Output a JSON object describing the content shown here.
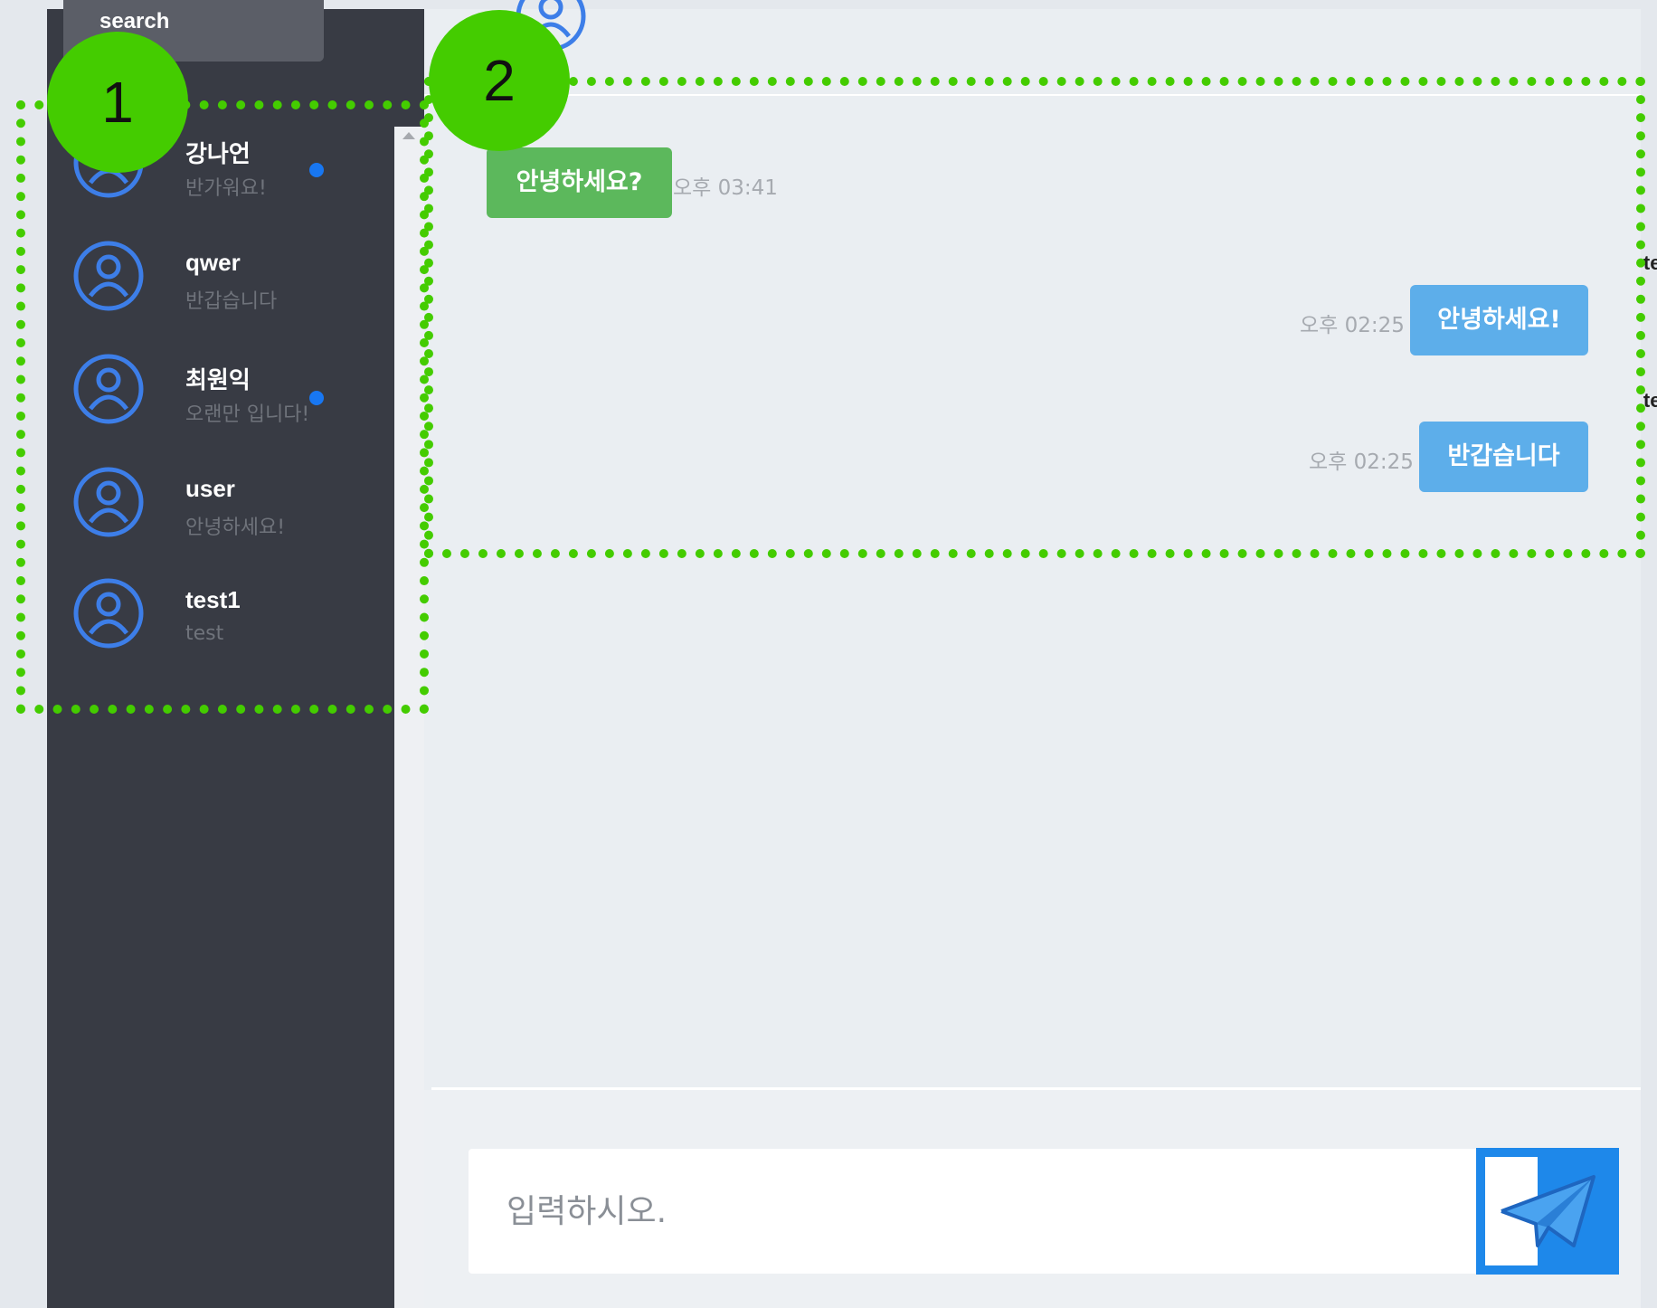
{
  "sidebar": {
    "search_label": "search",
    "contacts": [
      {
        "name": "강나언",
        "preview": "반가워요!",
        "unread": true
      },
      {
        "name": "qwer",
        "preview": "반갑습니다",
        "unread": false
      },
      {
        "name": "최원익",
        "preview": "오랜만 입니다!",
        "unread": true
      },
      {
        "name": "user",
        "preview": "안녕하세요!",
        "unread": false
      },
      {
        "name": "test1",
        "preview": "test",
        "unread": false
      }
    ]
  },
  "chat": {
    "messages": [
      {
        "direction": "received",
        "text": "안녕하세요?",
        "time": "오후 03:41"
      },
      {
        "direction": "sent",
        "sender": "test",
        "text": "안녕하세요!",
        "time": "오후 02:25"
      },
      {
        "direction": "sent",
        "sender": "test",
        "text": "반갑습니다",
        "time": "오후 02:25"
      }
    ],
    "composer": {
      "placeholder": "입력하시오.",
      "send_icon": "paper-plane-icon"
    }
  },
  "annotations": {
    "label_1": "1",
    "label_2": "2"
  },
  "colors": {
    "sidebar_bg": "#383b44",
    "chat_bg": "#eaeef2",
    "received_bubble": "#5cb85c",
    "sent_bubble": "#5daeea",
    "accent_blue": "#1e88ea",
    "unread_dot": "#1877f2",
    "annotation_green": "#44cc00"
  }
}
